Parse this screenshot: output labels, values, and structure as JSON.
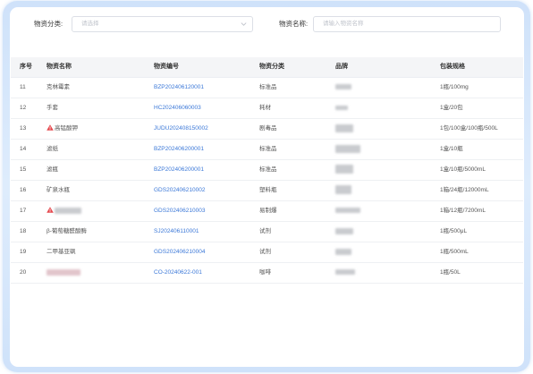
{
  "filters": {
    "category_label": "物资分类:",
    "category_placeholder": "请选择",
    "name_label": "物资名称:",
    "name_placeholder": "请输入物资名称"
  },
  "table": {
    "columns": [
      "序号",
      "物资名称",
      "物资编号",
      "物资分类",
      "品牌",
      "包装规格"
    ],
    "rows": [
      {
        "index": "11",
        "name": "克林霉素",
        "code": "BZP202406120001",
        "category": "标准品",
        "package": "1瓶/100mg",
        "warning": false
      },
      {
        "index": "12",
        "name": "手套",
        "code": "HC202406060003",
        "category": "耗材",
        "package": "1盒/20包",
        "warning": false
      },
      {
        "index": "13",
        "name": "高锰酸钾",
        "code": "JUDU202408150002",
        "category": "剧毒品",
        "package": "1包/100盒/100瓶/500L",
        "warning": true
      },
      {
        "index": "14",
        "name": "滤纸",
        "code": "BZP202406200001",
        "category": "标准品",
        "package": "1盒/10瓶",
        "warning": false
      },
      {
        "index": "15",
        "name": "滤瓶",
        "code": "BZP202406200001",
        "category": "标准品",
        "package": "1盒/10瓶/5000mL",
        "warning": false
      },
      {
        "index": "16",
        "name": "矿泉水瓶",
        "code": "GDS202406210002",
        "category": "塑料瓶",
        "package": "1箱/24瓶/12000mL",
        "warning": false
      },
      {
        "index": "17",
        "code": "GDS202406210003",
        "category": "易制爆",
        "package": "1箱/12瓶/7200mL",
        "warning": true
      },
      {
        "index": "18",
        "name": "β-葡萄糖醛酸酶",
        "code": "SJ202406110001",
        "category": "试剂",
        "package": "1瓶/500μL",
        "warning": false
      },
      {
        "index": "19",
        "name": "二甲基亚砜",
        "code": "GDS202406210004",
        "category": "试剂",
        "package": "1瓶/500mL",
        "warning": false
      },
      {
        "index": "20",
        "code": "CO-20240622-001",
        "category": "咖啡",
        "package": "1瓶/50L",
        "warning": false
      }
    ]
  },
  "colors": {
    "accent": "#3b78d8",
    "warning": "#e5484d",
    "frame": "#cfe2fa"
  },
  "icons": {
    "select_arrow": "chevron-down-icon",
    "hazard": "warning-icon"
  }
}
